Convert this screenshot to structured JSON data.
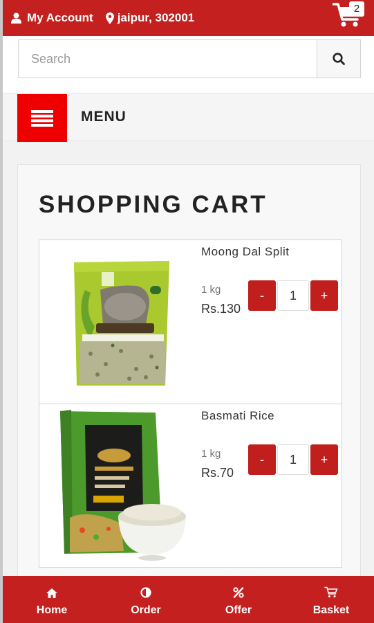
{
  "header": {
    "account_label": "My Account",
    "location": "jaipur, 302001",
    "cart_count": "2"
  },
  "search": {
    "placeholder": "Search",
    "value": ""
  },
  "menu": {
    "label": "MENU"
  },
  "cart_page": {
    "title": "SHOPPING CART",
    "items": [
      {
        "name": "Moong Dal Split",
        "weight": "1 kg",
        "price": "Rs.130",
        "quantity": "1",
        "minus": "-",
        "plus": "+"
      },
      {
        "name": "Basmati Rice",
        "weight": "1 kg",
        "price": "Rs.70",
        "quantity": "1",
        "minus": "-",
        "plus": "+"
      }
    ]
  },
  "bottom_nav": {
    "items": [
      {
        "label": "Home",
        "icon": "home-icon"
      },
      {
        "label": "Order",
        "icon": "half-circle-icon"
      },
      {
        "label": "Offer",
        "icon": "percent-icon"
      },
      {
        "label": "Basket",
        "icon": "basket-icon"
      }
    ]
  },
  "colors": {
    "brand_red": "#c3201f",
    "menu_red": "#ee0000"
  }
}
